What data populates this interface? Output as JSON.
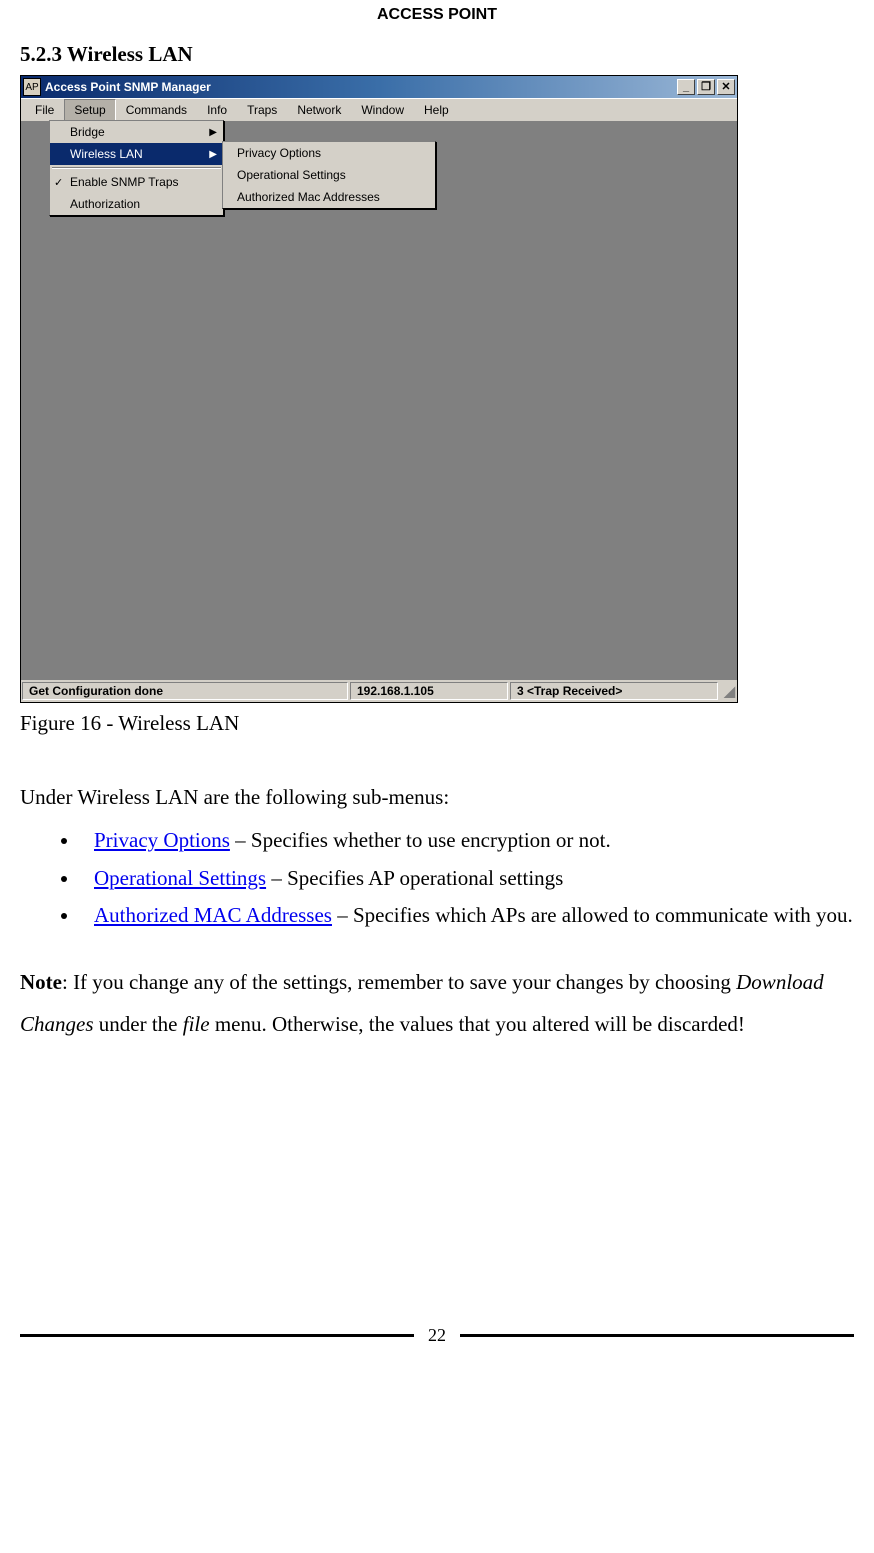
{
  "header": "ACCESS POINT",
  "section_heading": "5.2.3 Wireless LAN",
  "caption": "Figure 16 - Wireless LAN",
  "intro": "Under Wireless LAN are the following sub-menus:",
  "bullets": [
    {
      "link": "Privacy Options",
      "rest": " – Specifies whether to use encryption or not."
    },
    {
      "link": "Operational Settings",
      "rest": " – Specifies AP operational settings"
    },
    {
      "link": "Authorized MAC Addresses",
      "rest": " – Specifies which APs are allowed to communicate with you."
    }
  ],
  "note_label": "Note",
  "note_part1": ": If you change any of the settings, remember to save your changes by choosing ",
  "note_italic1": "Download Changes",
  "note_part2": " under the ",
  "note_italic2": "file",
  "note_part3": " menu. Otherwise, the values that you altered will be discarded!",
  "page_number": "22",
  "window": {
    "title": "Access Point SNMP Manager",
    "app_icon_label": "AP",
    "menubar": [
      "File",
      "Setup",
      "Commands",
      "Info",
      "Traps",
      "Network",
      "Window",
      "Help"
    ],
    "setup_menu": {
      "items": [
        {
          "label": "Bridge",
          "arrow": true,
          "checked": false
        },
        {
          "label": "Wireless LAN",
          "arrow": true,
          "checked": false,
          "highlight": true
        },
        {
          "label": "Enable SNMP Traps",
          "arrow": false,
          "checked": true
        },
        {
          "label": "Authorization",
          "arrow": false,
          "checked": false
        }
      ]
    },
    "wlan_submenu": [
      "Privacy Options",
      "Operational Settings",
      "Authorized Mac Addresses"
    ],
    "statusbar": {
      "a": "Get Configuration done",
      "b": "192.168.1.105",
      "c": "3 <Trap Received>"
    },
    "controls": {
      "min": "_",
      "restore": "❐",
      "close": "✕"
    }
  }
}
